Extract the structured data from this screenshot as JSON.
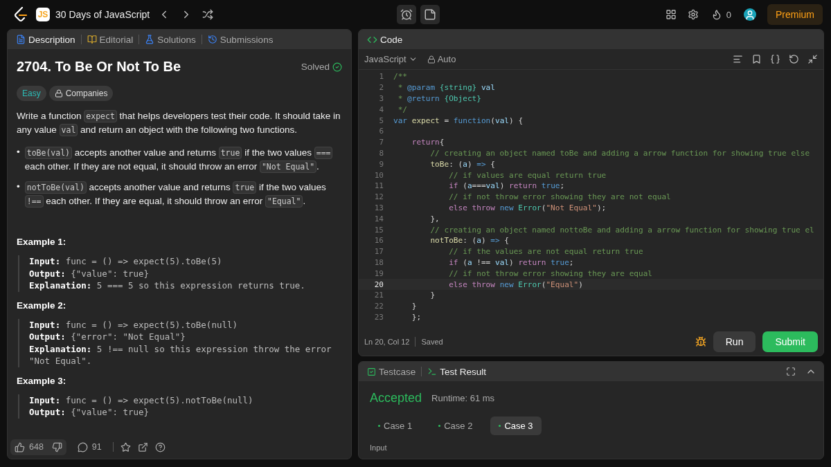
{
  "topbar": {
    "badge": "JS",
    "title": "30 Days of JavaScript",
    "streak": "0",
    "premium": "Premium"
  },
  "left_panel": {
    "tabs": [
      {
        "label": "Description",
        "selected": true
      },
      {
        "label": "Editorial",
        "selected": false
      },
      {
        "label": "Solutions",
        "selected": false
      },
      {
        "label": "Submissions",
        "selected": false
      }
    ],
    "title": "2704. To Be Or Not To Be",
    "status": "Solved",
    "difficulty": "Easy",
    "companies": "Companies",
    "paragraph": [
      {
        "t": "Write a function ",
        "kind": "text"
      },
      {
        "t": "expect",
        "kind": "code"
      },
      {
        "t": " that helps developers test their code. It should take in any value ",
        "kind": "text"
      },
      {
        "t": "val",
        "kind": "code"
      },
      {
        "t": " and return an object with the following two functions.",
        "kind": "text"
      }
    ],
    "bullets": [
      {
        "marker": "•",
        "parts": [
          {
            "t": "toBe(val)",
            "kind": "code"
          },
          {
            "t": " accepts another value and returns ",
            "kind": "text"
          },
          {
            "t": "true",
            "kind": "code"
          },
          {
            "t": " if the two values ",
            "kind": "text"
          },
          {
            "t": "===",
            "kind": "code"
          },
          {
            "t": " each other. If they are not equal, it should throw an error ",
            "kind": "text"
          },
          {
            "t": "\"Not Equal\"",
            "kind": "code"
          },
          {
            "t": ".",
            "kind": "text"
          }
        ]
      },
      {
        "marker": "•",
        "parts": [
          {
            "t": "notToBe(val)",
            "kind": "code"
          },
          {
            "t": " accepts another value and returns ",
            "kind": "text"
          },
          {
            "t": "true",
            "kind": "code"
          },
          {
            "t": " if the two values ",
            "kind": "text"
          },
          {
            "t": "!==",
            "kind": "code"
          },
          {
            "t": " each other. If they are equal, it should throw an error ",
            "kind": "text"
          },
          {
            "t": "\"Equal\"",
            "kind": "code"
          },
          {
            "t": ".",
            "kind": "text"
          }
        ]
      }
    ],
    "examples": [
      {
        "heading": "Example 1:",
        "lines": [
          "**Input:** func = () => expect(5).toBe(5)",
          "**Output:** {\"value\": true}",
          "**Explanation:** 5 === 5 so this expression returns true."
        ]
      },
      {
        "heading": "Example 2:",
        "lines": [
          "**Input:** func = () => expect(5).toBe(null)",
          "**Output:** {\"error\": \"Not Equal\"}",
          "**Explanation:** 5 !== null so this expression throw the error \"Not Equal\"."
        ]
      },
      {
        "heading": "Example 3:",
        "lines": [
          "**Input:** func = () => expect(5).notToBe(null)",
          "**Output:** {\"value\": true}"
        ]
      }
    ],
    "likes": "648",
    "comments": "91"
  },
  "code_panel": {
    "title": "Code",
    "language": "JavaScript",
    "mode": "Auto",
    "lines": [
      {
        "n": "1",
        "current": false,
        "tokens": [
          {
            "kind": "comment",
            "t": "/**"
          }
        ]
      },
      {
        "n": "2",
        "current": false,
        "tokens": [
          {
            "kind": "comment",
            "t": " * "
          },
          {
            "kind": "keyword",
            "t": "@param"
          },
          {
            "kind": "type",
            "t": " {string}"
          },
          {
            "kind": "var",
            "t": " val"
          }
        ]
      },
      {
        "n": "3",
        "current": false,
        "tokens": [
          {
            "kind": "comment",
            "t": " * "
          },
          {
            "kind": "keyword",
            "t": "@return"
          },
          {
            "kind": "type",
            "t": " {Object}"
          }
        ]
      },
      {
        "n": "4",
        "current": false,
        "tokens": [
          {
            "kind": "comment",
            "t": " */"
          }
        ]
      },
      {
        "n": "5",
        "current": false,
        "tokens": [
          {
            "kind": "keyword",
            "t": "var"
          },
          {
            "kind": "fn",
            "t": " expect"
          },
          {
            "kind": "plain",
            "t": " = "
          },
          {
            "kind": "keyword",
            "t": "function"
          },
          {
            "kind": "plain",
            "t": "("
          },
          {
            "kind": "var",
            "t": "val"
          },
          {
            "kind": "plain",
            "t": ") {"
          }
        ]
      },
      {
        "n": "6",
        "current": false
      },
      {
        "n": "7",
        "current": false,
        "tokens": [
          {
            "kind": "control",
            "t": "    return"
          },
          {
            "kind": "plain",
            "t": "{"
          }
        ]
      },
      {
        "n": "8",
        "current": false,
        "tokens": [
          {
            "kind": "comment",
            "t": "        // creating an object named toBe and adding a arrow function for showing true else"
          }
        ]
      },
      {
        "n": "9",
        "current": false,
        "tokens": [
          {
            "kind": "fn",
            "t": "        toBe"
          },
          {
            "kind": "plain",
            "t": ": ("
          },
          {
            "kind": "var",
            "t": "a"
          },
          {
            "kind": "plain",
            "t": ") "
          },
          {
            "kind": "keyword",
            "t": "=>"
          },
          {
            "kind": "plain",
            "t": " {"
          }
        ]
      },
      {
        "n": "10",
        "current": false,
        "tokens": [
          {
            "kind": "comment",
            "t": "            // if values are equal return true"
          }
        ]
      },
      {
        "n": "11",
        "current": false,
        "tokens": [
          {
            "kind": "control",
            "t": "            if"
          },
          {
            "kind": "plain",
            "t": " ("
          },
          {
            "kind": "var",
            "t": "a"
          },
          {
            "kind": "plain",
            "t": "==="
          },
          {
            "kind": "var",
            "t": "val"
          },
          {
            "kind": "plain",
            "t": ") "
          },
          {
            "kind": "control",
            "t": "return"
          },
          {
            "kind": "keyword",
            "t": " true"
          },
          {
            "kind": "plain",
            "t": ";"
          }
        ]
      },
      {
        "n": "12",
        "current": false,
        "tokens": [
          {
            "kind": "comment",
            "t": "            // if not throw error showing they are not equal"
          }
        ]
      },
      {
        "n": "13",
        "current": false,
        "tokens": [
          {
            "kind": "control",
            "t": "            else throw"
          },
          {
            "kind": "keyword",
            "t": " new"
          },
          {
            "kind": "type",
            "t": " Error"
          },
          {
            "kind": "plain",
            "t": "("
          },
          {
            "kind": "string",
            "t": "\"Not Equal\""
          },
          {
            "kind": "plain",
            "t": ");"
          }
        ]
      },
      {
        "n": "14",
        "current": false,
        "tokens": [
          {
            "kind": "plain",
            "t": "        },"
          }
        ]
      },
      {
        "n": "15",
        "current": false,
        "tokens": [
          {
            "kind": "comment",
            "t": "        // creating an object named nottoBe and adding a arrow function for showing true el"
          }
        ]
      },
      {
        "n": "16",
        "current": false,
        "tokens": [
          {
            "kind": "fn",
            "t": "        notToBe"
          },
          {
            "kind": "plain",
            "t": ": ("
          },
          {
            "kind": "var",
            "t": "a"
          },
          {
            "kind": "plain",
            "t": ") "
          },
          {
            "kind": "keyword",
            "t": "=>"
          },
          {
            "kind": "plain",
            "t": " {"
          }
        ]
      },
      {
        "n": "17",
        "current": false,
        "tokens": [
          {
            "kind": "comment",
            "t": "            // if the values are not equal return true"
          }
        ]
      },
      {
        "n": "18",
        "current": false,
        "tokens": [
          {
            "kind": "control",
            "t": "            if"
          },
          {
            "kind": "plain",
            "t": " ("
          },
          {
            "kind": "var",
            "t": "a"
          },
          {
            "kind": "plain",
            "t": " !== "
          },
          {
            "kind": "var",
            "t": "val"
          },
          {
            "kind": "plain",
            "t": ") "
          },
          {
            "kind": "control",
            "t": "return"
          },
          {
            "kind": "keyword",
            "t": " true"
          },
          {
            "kind": "plain",
            "t": ";"
          }
        ]
      },
      {
        "n": "19",
        "current": false,
        "tokens": [
          {
            "kind": "comment",
            "t": "            // if not throw error showing they are equal"
          }
        ]
      },
      {
        "n": "20",
        "current": true,
        "tokens": [
          {
            "kind": "control",
            "t": "            else throw"
          },
          {
            "kind": "keyword",
            "t": " new"
          },
          {
            "kind": "type",
            "t": " Error"
          },
          {
            "kind": "plain",
            "t": "("
          },
          {
            "kind": "string",
            "t": "\"Equal\""
          },
          {
            "kind": "plain",
            "t": ")"
          }
        ]
      },
      {
        "n": "21",
        "current": false,
        "tokens": [
          {
            "kind": "plain",
            "t": "        }"
          }
        ]
      },
      {
        "n": "22",
        "current": false,
        "tokens": [
          {
            "kind": "plain",
            "t": "    }"
          }
        ]
      },
      {
        "n": "23",
        "current": false,
        "tokens": [
          {
            "kind": "plain",
            "t": "    };"
          }
        ]
      }
    ],
    "cursor": "Ln 20, Col 12",
    "save_state": "Saved",
    "run": "Run",
    "submit": "Submit"
  },
  "test_panel": {
    "tabs": [
      {
        "label": "Testcase",
        "selected": false
      },
      {
        "label": "Test Result",
        "selected": true
      }
    ],
    "verdict": "Accepted",
    "runtime": "Runtime: 61 ms",
    "cases": [
      {
        "label": "Case 1",
        "selected": false
      },
      {
        "label": "Case 2",
        "selected": false
      },
      {
        "label": "Case 3",
        "selected": true
      }
    ],
    "input_label": "Input"
  }
}
